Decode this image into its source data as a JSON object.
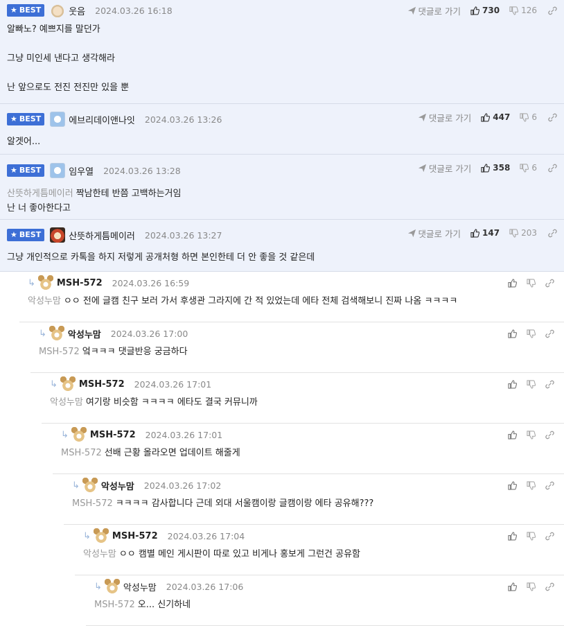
{
  "best_comments": [
    {
      "badge": "BEST",
      "author": "웃음",
      "date": "2024.03.26 16:18",
      "reply_go": "댓글로 가기",
      "likes": "730",
      "dislikes": "126",
      "lines": [
        "알빠노? 예쁘지를 말던가",
        "",
        "그냥 미인세 낸다고 생각해라",
        "",
        "난 앞으로도 전진 전진만 있을 뿐"
      ]
    },
    {
      "badge": "BEST",
      "author": "에브리데이앤나잇",
      "date": "2024.03.26 13:26",
      "reply_go": "댓글로 가기",
      "likes": "447",
      "dislikes": "6",
      "lines": [
        "알겟어..."
      ]
    },
    {
      "badge": "BEST",
      "author": "임우열",
      "date": "2024.03.26 13:28",
      "reply_go": "댓글로 가기",
      "likes": "358",
      "dislikes": "6",
      "mention": "산뜻하게틈메이러",
      "lines": [
        "짝남한테 반쯤 고백하는거임",
        "난 너 좋아한다고"
      ]
    },
    {
      "badge": "BEST",
      "author": "산뜻하게틈메이러",
      "date": "2024.03.26 13:27",
      "reply_go": "댓글로 가기",
      "likes": "147",
      "dislikes": "203",
      "lines": [
        "그냥 개인적으로 카톡을 하지 저렇게 공개처형 하면 본인한테 더 안 좋을 것 같은데"
      ]
    }
  ],
  "replies": [
    {
      "author": "MSH-572",
      "date": "2024.03.26 16:59",
      "mention": "악성누맘",
      "text": "ㅇㅇ 전에 글캠 친구 보러 가서 후생관 그라지에 간 적 있었는데 에타 전체 검색해보니 진짜 나옴 ㅋㅋㅋㅋ"
    },
    {
      "author": "악성누맘",
      "date": "2024.03.26 17:00",
      "mention": "MSH-572",
      "text": "엌ㅋㅋㅋ 댓글반응 궁금하다"
    },
    {
      "author": "MSH-572",
      "date": "2024.03.26 17:01",
      "mention": "악성누맘",
      "text": "여기랑 비슷함 ㅋㅋㅋㅋ 에타도 결국 커뮤니까"
    },
    {
      "author": "MSH-572",
      "date": "2024.03.26 17:01",
      "mention": "MSH-572",
      "text": "선배 근황 올라오면 업데이트 해줄게"
    },
    {
      "author": "악성누맘",
      "date": "2024.03.26 17:02",
      "mention": "MSH-572",
      "text": "ㅋㅋㅋㅋ 감사합니다 근데 외대 서울캠이랑 글캠이랑 에타 공유해???"
    },
    {
      "author": "MSH-572",
      "date": "2024.03.26 17:04",
      "mention": "악성누맘",
      "text": "ㅇㅇ 캠별 메인 게시판이 따로 있고 비게나 홍보게 그런건 공유함"
    },
    {
      "author": "악성누맘",
      "date": "2024.03.26 17:06",
      "mention": "MSH-572",
      "text": "오... 신기하네"
    }
  ]
}
